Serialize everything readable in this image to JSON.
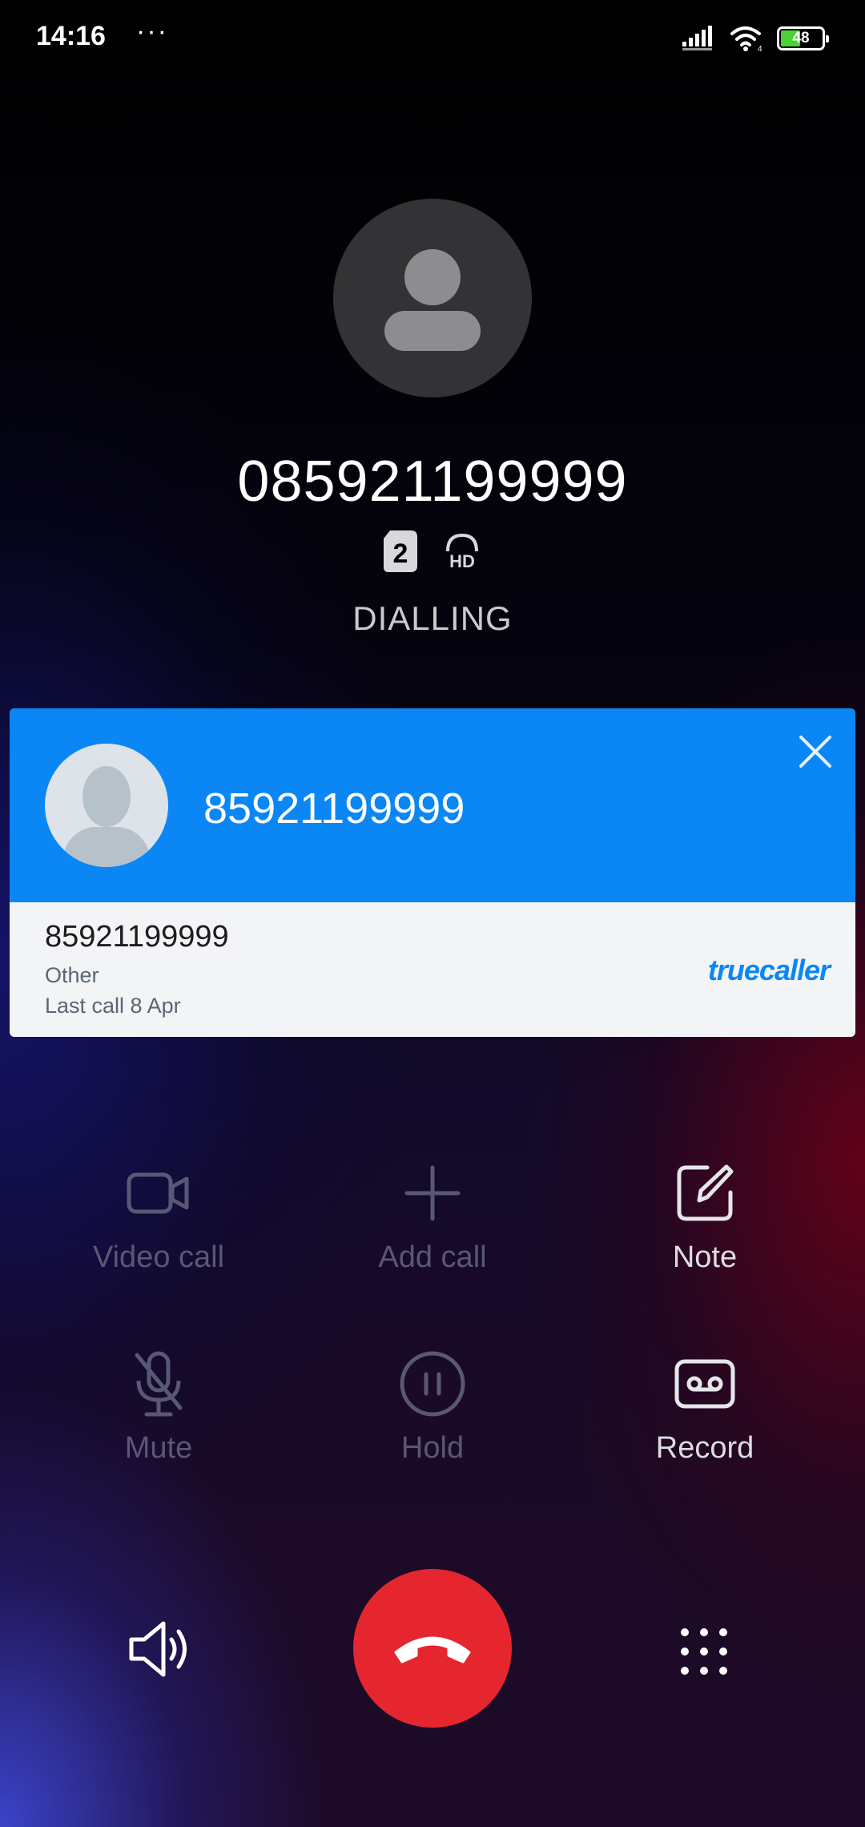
{
  "status_bar": {
    "time": "14:16",
    "more": "···",
    "battery_level": "48",
    "battery_fraction": 0.48
  },
  "call": {
    "number": "085921199999",
    "sim_slot": "2",
    "hd_badge": "HD",
    "status": "DIALLING"
  },
  "truecaller": {
    "name": "85921199999",
    "number": "85921199999",
    "type": "Other",
    "last_call": "Last call 8 Apr",
    "logo": "truecaller",
    "accent": "#0a87f4"
  },
  "actions": [
    {
      "label": "Video call",
      "icon": "video-camera-icon",
      "enabled": false
    },
    {
      "label": "Add call",
      "icon": "plus-icon",
      "enabled": false
    },
    {
      "label": "Note",
      "icon": "note-edit-icon",
      "enabled": true
    },
    {
      "label": "Mute",
      "icon": "mic-off-icon",
      "enabled": false
    },
    {
      "label": "Hold",
      "icon": "pause-icon",
      "enabled": false
    },
    {
      "label": "Record",
      "icon": "record-tape-icon",
      "enabled": true
    }
  ],
  "controls": {
    "speaker_icon": "speaker-icon",
    "end_call_icon": "hang-up-icon",
    "keypad_icon": "dialpad-icon",
    "end_call_color": "#e5262f"
  }
}
